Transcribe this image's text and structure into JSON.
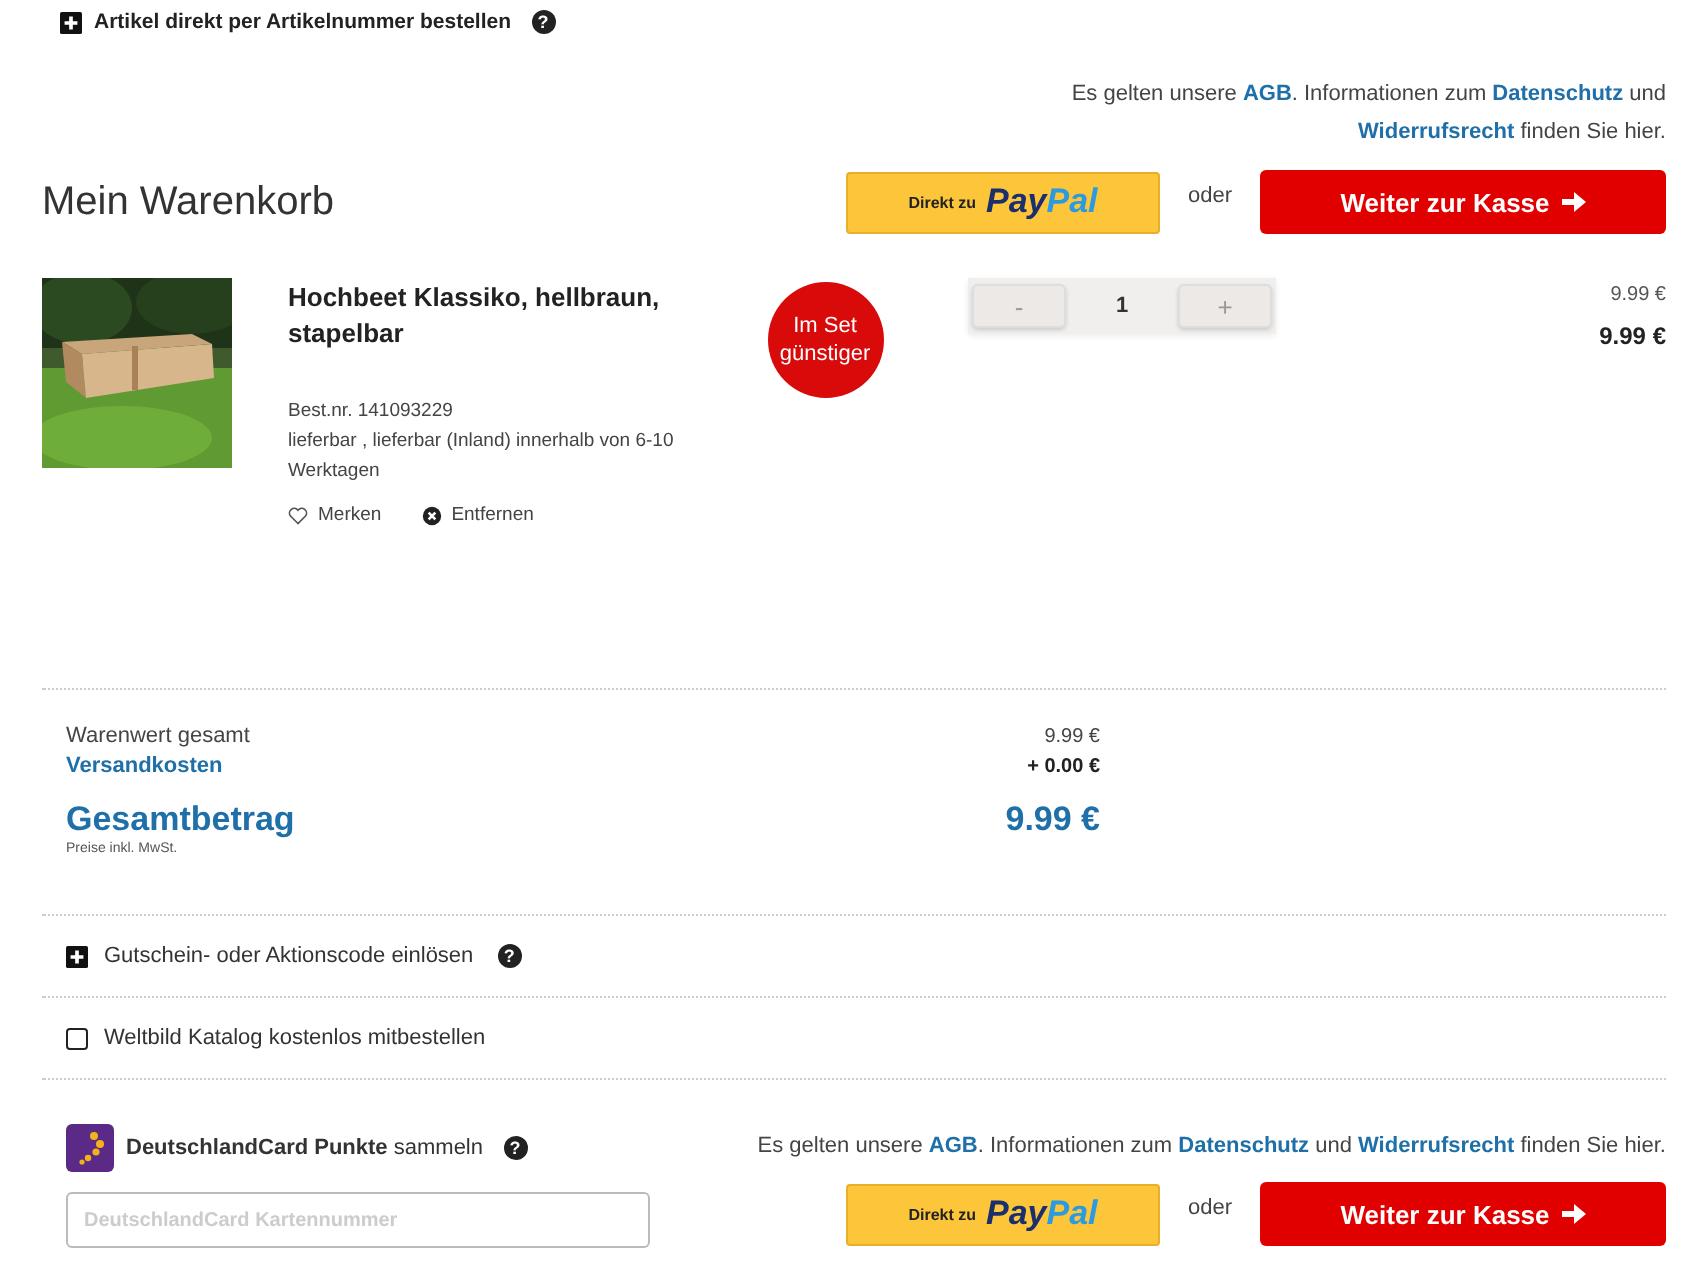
{
  "quick_order": {
    "label": "Artikel direkt per Artikelnummer bestellen",
    "help": "?"
  },
  "legal_top": [
    {
      "kind": "text",
      "text": "Es gelten unsere "
    },
    {
      "kind": "link",
      "text": "AGB"
    },
    {
      "kind": "text",
      "text": ". Informationen zum "
    },
    {
      "kind": "link",
      "text": "Datenschutz"
    },
    {
      "kind": "text",
      "text": " und "
    },
    {
      "kind": "link",
      "text": "Widerrufsrecht"
    },
    {
      "kind": "text",
      "text": " finden Sie hier."
    }
  ],
  "title": "Mein Warenkorb",
  "top_actions": {
    "paypal_prefix": "Direkt zu",
    "paypal_a": "Pay",
    "paypal_b": "Pal",
    "or": "oder",
    "checkout": "Weiter zur Kasse"
  },
  "item": {
    "kind": "picture",
    "name": "Hochbeet Klassiko, hellbraun, stapelbar",
    "badge": "Im Set günstiger",
    "order_no": "Best.nr. 141093229",
    "availability": "lieferbar , lieferbar (Inland) innerhalb von 6-10 Werktagen",
    "remember": "Merken",
    "remove": "Entfernen",
    "minus": "-",
    "quantity": "1",
    "plus": "+",
    "unit_price": "9.99 €",
    "total_price": "9.99 €"
  },
  "summary": {
    "rows": [
      {
        "label": "Warenwert gesamt",
        "value": "9.99 €",
        "kind": "plain"
      },
      {
        "label": "Versandkosten",
        "value": "+ 0.00 €",
        "kind": "link"
      }
    ],
    "total_label": "Gesamtbetrag",
    "total_value": "9.99 €",
    "tax_note": "Preise inkl. MwSt."
  },
  "voucher": {
    "label": "Gutschein- oder Aktionscode einlösen",
    "help": "?"
  },
  "catalog": {
    "label": "Weltbild Katalog kostenlos mitbestellen",
    "checked": false
  },
  "dcard": {
    "label_bold": "DeutschlandCard Punkte",
    "label_rest": "sammeln",
    "help": "?",
    "placeholder": "DeutschlandCard Kartennummer"
  },
  "legal_bottom": [
    {
      "kind": "text",
      "text": "Es gelten unsere "
    },
    {
      "kind": "link",
      "text": "AGB"
    },
    {
      "kind": "text",
      "text": ". Informationen zum "
    },
    {
      "kind": "link",
      "text": "Datenschutz"
    },
    {
      "kind": "text",
      "text": " und "
    },
    {
      "kind": "link",
      "text": "Widerrufsrecht"
    },
    {
      "kind": "text",
      "text": " finden Sie hier."
    }
  ],
  "bottom_actions": {
    "paypal_prefix": "Direkt zu",
    "paypal_a": "Pay",
    "paypal_b": "Pal",
    "or": "oder",
    "checkout": "Weiter zur Kasse"
  }
}
